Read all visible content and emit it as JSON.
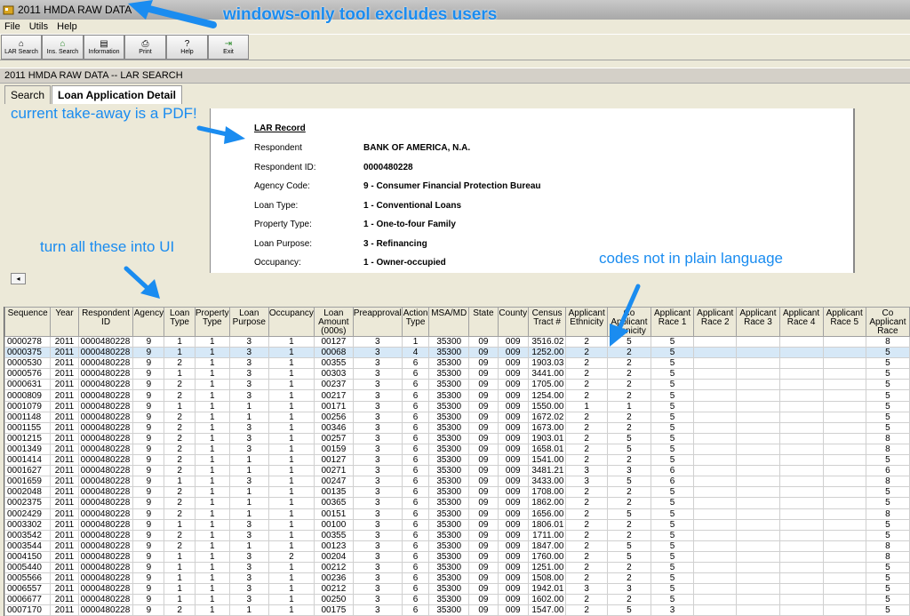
{
  "window": {
    "title": "2011 HMDA RAW DATA"
  },
  "menu": [
    "File",
    "Utils",
    "Help"
  ],
  "toolbar": [
    {
      "label": "LAR Search",
      "icon": "home-icon"
    },
    {
      "label": "Ins. Search",
      "icon": "house-search-icon"
    },
    {
      "label": "Information",
      "icon": "document-icon"
    },
    {
      "label": "Print",
      "icon": "printer-icon"
    },
    {
      "label": "Help",
      "icon": "help-icon"
    },
    {
      "label": "Exit",
      "icon": "exit-icon"
    }
  ],
  "panel": {
    "title": "2011 HMDA RAW DATA -- LAR SEARCH"
  },
  "tabs": [
    {
      "label": "Search"
    },
    {
      "label": "Loan Application Detail"
    }
  ],
  "record": {
    "title": "LAR Record",
    "fields": [
      {
        "label": "Respondent",
        "value": "BANK OF AMERICA, N.A."
      },
      {
        "label": "Respondent ID:",
        "value": "0000480228"
      },
      {
        "label": "Agency Code:",
        "value": "9 - Consumer Financial Protection Bureau"
      },
      {
        "label": "Loan Type:",
        "value": "1 - Conventional Loans"
      },
      {
        "label": "Property Type:",
        "value": "1 - One-to-four Family"
      },
      {
        "label": "Loan Purpose:",
        "value": "3 - Refinancing"
      },
      {
        "label": "Occupancy:",
        "value": "1 - Owner-occupied"
      }
    ]
  },
  "annotations": {
    "windows": "windows-only tool excludes users",
    "pdf": "current take-away is a PDF!",
    "ui": "turn all these into UI",
    "codes": "codes not in plain language"
  },
  "grid": {
    "columns": [
      "Sequence",
      "Year",
      "Respondent ID",
      "Agency",
      "Loan Type",
      "Property Type",
      "Loan Purpose",
      "Occupancy",
      "Loan Amount (000s)",
      "Preapproval",
      "Action Type",
      "MSA/MD",
      "State",
      "County",
      "Census Tract #",
      "Applicant Ethnicity",
      "Co Applicant Ethnicity",
      "Applicant Race 1",
      "Applicant Race 2",
      "Applicant Race 3",
      "Applicant Race 4",
      "Applicant Race 5",
      "Co Applicant Race"
    ],
    "selected_row": 1,
    "rows": [
      [
        "0000278",
        "2011",
        "0000480228",
        "9",
        "1",
        "1",
        "3",
        "1",
        "00127",
        "3",
        "1",
        "35300",
        "09",
        "009",
        "3516.02",
        "2",
        "5",
        "5",
        "",
        "",
        "",
        "",
        "8"
      ],
      [
        "0000375",
        "2011",
        "0000480228",
        "9",
        "1",
        "1",
        "3",
        "1",
        "00068",
        "3",
        "4",
        "35300",
        "09",
        "009",
        "1252.00",
        "2",
        "2",
        "5",
        "",
        "",
        "",
        "",
        "5"
      ],
      [
        "0000530",
        "2011",
        "0000480228",
        "9",
        "2",
        "1",
        "3",
        "1",
        "00355",
        "3",
        "6",
        "35300",
        "09",
        "009",
        "1903.03",
        "2",
        "2",
        "5",
        "",
        "",
        "",
        "",
        "5"
      ],
      [
        "0000576",
        "2011",
        "0000480228",
        "9",
        "1",
        "1",
        "3",
        "1",
        "00303",
        "3",
        "6",
        "35300",
        "09",
        "009",
        "3441.00",
        "2",
        "2",
        "5",
        "",
        "",
        "",
        "",
        "5"
      ],
      [
        "0000631",
        "2011",
        "0000480228",
        "9",
        "2",
        "1",
        "3",
        "1",
        "00237",
        "3",
        "6",
        "35300",
        "09",
        "009",
        "1705.00",
        "2",
        "2",
        "5",
        "",
        "",
        "",
        "",
        "5"
      ],
      [
        "0000809",
        "2011",
        "0000480228",
        "9",
        "2",
        "1",
        "3",
        "1",
        "00217",
        "3",
        "6",
        "35300",
        "09",
        "009",
        "1254.00",
        "2",
        "2",
        "5",
        "",
        "",
        "",
        "",
        "5"
      ],
      [
        "0001079",
        "2011",
        "0000480228",
        "9",
        "1",
        "1",
        "1",
        "1",
        "00171",
        "3",
        "6",
        "35300",
        "09",
        "009",
        "1550.00",
        "1",
        "1",
        "5",
        "",
        "",
        "",
        "",
        "5"
      ],
      [
        "0001148",
        "2011",
        "0000480228",
        "9",
        "2",
        "1",
        "1",
        "1",
        "00256",
        "3",
        "6",
        "35300",
        "09",
        "009",
        "1672.02",
        "2",
        "2",
        "5",
        "",
        "",
        "",
        "",
        "5"
      ],
      [
        "0001155",
        "2011",
        "0000480228",
        "9",
        "2",
        "1",
        "3",
        "1",
        "00346",
        "3",
        "6",
        "35300",
        "09",
        "009",
        "1673.00",
        "2",
        "2",
        "5",
        "",
        "",
        "",
        "",
        "5"
      ],
      [
        "0001215",
        "2011",
        "0000480228",
        "9",
        "2",
        "1",
        "3",
        "1",
        "00257",
        "3",
        "6",
        "35300",
        "09",
        "009",
        "1903.01",
        "2",
        "5",
        "5",
        "",
        "",
        "",
        "",
        "8"
      ],
      [
        "0001349",
        "2011",
        "0000480228",
        "9",
        "2",
        "1",
        "3",
        "1",
        "00159",
        "3",
        "6",
        "35300",
        "09",
        "009",
        "1658.01",
        "2",
        "5",
        "5",
        "",
        "",
        "",
        "",
        "8"
      ],
      [
        "0001414",
        "2011",
        "0000480228",
        "9",
        "2",
        "1",
        "1",
        "1",
        "00127",
        "3",
        "6",
        "35300",
        "09",
        "009",
        "1541.00",
        "2",
        "2",
        "5",
        "",
        "",
        "",
        "",
        "5"
      ],
      [
        "0001627",
        "2011",
        "0000480228",
        "9",
        "2",
        "1",
        "1",
        "1",
        "00271",
        "3",
        "6",
        "35300",
        "09",
        "009",
        "3481.21",
        "3",
        "3",
        "6",
        "",
        "",
        "",
        "",
        "6"
      ],
      [
        "0001659",
        "2011",
        "0000480228",
        "9",
        "1",
        "1",
        "3",
        "1",
        "00247",
        "3",
        "6",
        "35300",
        "09",
        "009",
        "3433.00",
        "3",
        "5",
        "6",
        "",
        "",
        "",
        "",
        "8"
      ],
      [
        "0002048",
        "2011",
        "0000480228",
        "9",
        "2",
        "1",
        "1",
        "1",
        "00135",
        "3",
        "6",
        "35300",
        "09",
        "009",
        "1708.00",
        "2",
        "2",
        "5",
        "",
        "",
        "",
        "",
        "5"
      ],
      [
        "0002375",
        "2011",
        "0000480228",
        "9",
        "2",
        "1",
        "1",
        "1",
        "00365",
        "3",
        "6",
        "35300",
        "09",
        "009",
        "1862.00",
        "2",
        "2",
        "5",
        "",
        "",
        "",
        "",
        "5"
      ],
      [
        "0002429",
        "2011",
        "0000480228",
        "9",
        "2",
        "1",
        "1",
        "1",
        "00151",
        "3",
        "6",
        "35300",
        "09",
        "009",
        "1656.00",
        "2",
        "5",
        "5",
        "",
        "",
        "",
        "",
        "8"
      ],
      [
        "0003302",
        "2011",
        "0000480228",
        "9",
        "1",
        "1",
        "3",
        "1",
        "00100",
        "3",
        "6",
        "35300",
        "09",
        "009",
        "1806.01",
        "2",
        "2",
        "5",
        "",
        "",
        "",
        "",
        "5"
      ],
      [
        "0003542",
        "2011",
        "0000480228",
        "9",
        "2",
        "1",
        "3",
        "1",
        "00355",
        "3",
        "6",
        "35300",
        "09",
        "009",
        "1711.00",
        "2",
        "2",
        "5",
        "",
        "",
        "",
        "",
        "5"
      ],
      [
        "0003544",
        "2011",
        "0000480228",
        "9",
        "2",
        "1",
        "1",
        "1",
        "00123",
        "3",
        "6",
        "35300",
        "09",
        "009",
        "1847.00",
        "2",
        "5",
        "5",
        "",
        "",
        "",
        "",
        "8"
      ],
      [
        "0004150",
        "2011",
        "0000480228",
        "9",
        "1",
        "1",
        "3",
        "2",
        "00204",
        "3",
        "6",
        "35300",
        "09",
        "009",
        "1760.00",
        "2",
        "5",
        "5",
        "",
        "",
        "",
        "",
        "8"
      ],
      [
        "0005440",
        "2011",
        "0000480228",
        "9",
        "1",
        "1",
        "3",
        "1",
        "00212",
        "3",
        "6",
        "35300",
        "09",
        "009",
        "1251.00",
        "2",
        "2",
        "5",
        "",
        "",
        "",
        "",
        "5"
      ],
      [
        "0005566",
        "2011",
        "0000480228",
        "9",
        "1",
        "1",
        "3",
        "1",
        "00236",
        "3",
        "6",
        "35300",
        "09",
        "009",
        "1508.00",
        "2",
        "2",
        "5",
        "",
        "",
        "",
        "",
        "5"
      ],
      [
        "0006557",
        "2011",
        "0000480228",
        "9",
        "1",
        "1",
        "3",
        "1",
        "00212",
        "3",
        "6",
        "35300",
        "09",
        "009",
        "1942.01",
        "3",
        "3",
        "5",
        "",
        "",
        "",
        "",
        "5"
      ],
      [
        "0006677",
        "2011",
        "0000480228",
        "9",
        "1",
        "1",
        "3",
        "1",
        "00250",
        "3",
        "6",
        "35300",
        "09",
        "009",
        "1602.00",
        "2",
        "2",
        "5",
        "",
        "",
        "",
        "",
        "5"
      ],
      [
        "0007170",
        "2011",
        "0000480228",
        "9",
        "2",
        "1",
        "1",
        "1",
        "00175",
        "3",
        "6",
        "35300",
        "09",
        "009",
        "1547.00",
        "2",
        "5",
        "3",
        "",
        "",
        "",
        "",
        "5"
      ]
    ]
  }
}
